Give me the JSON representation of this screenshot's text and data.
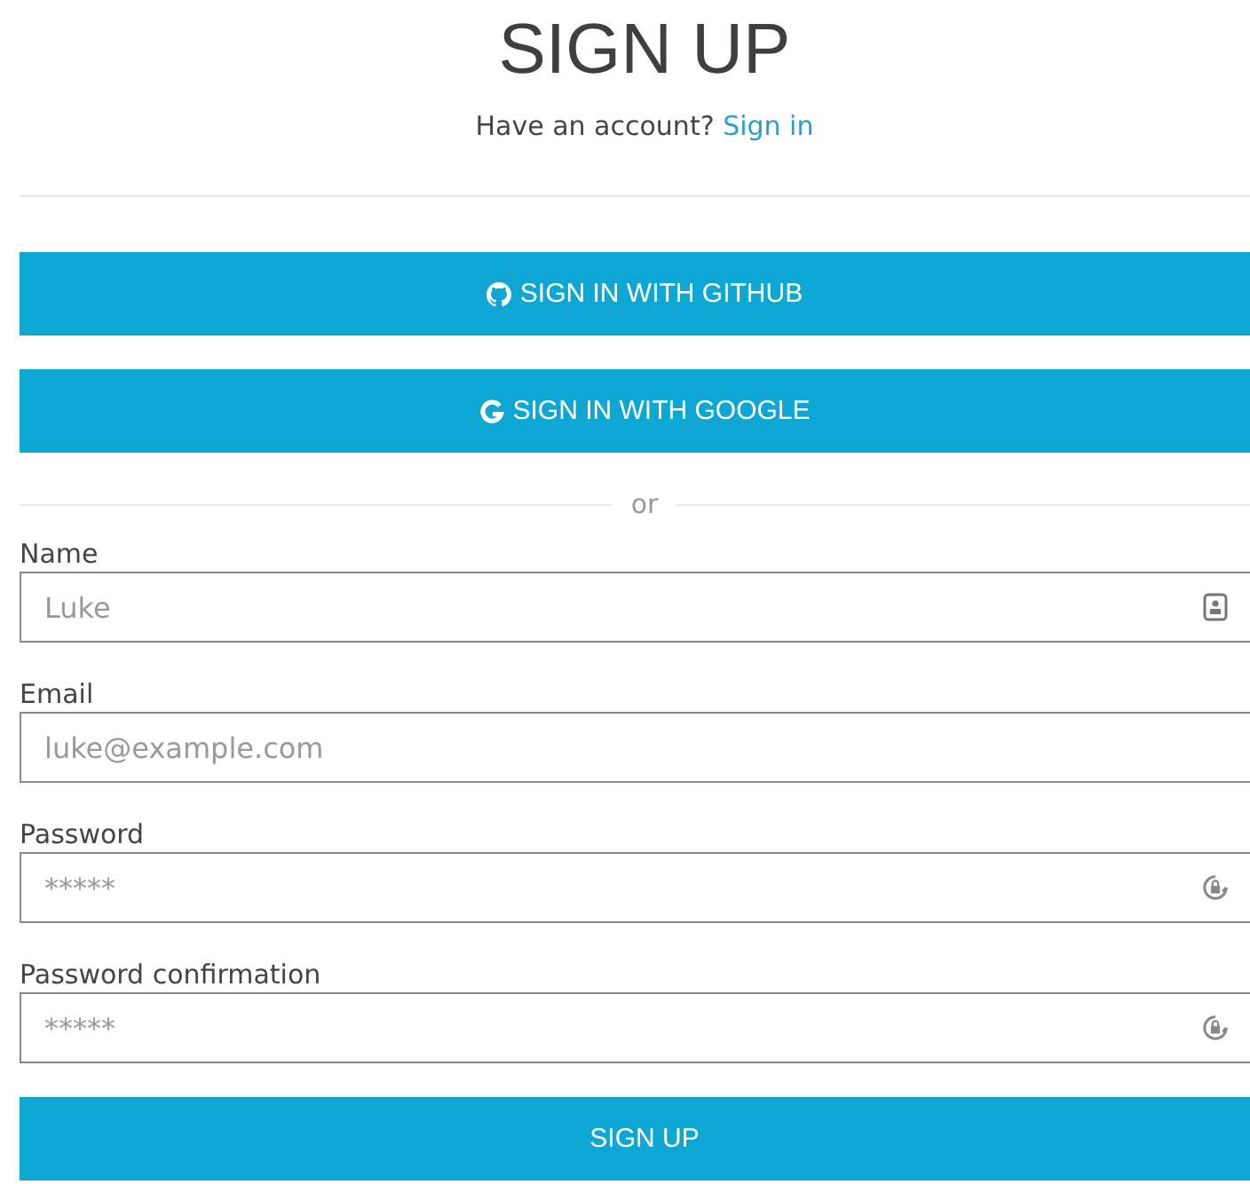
{
  "title": "SIGN UP",
  "subtitle": {
    "text": "Have an account?",
    "link": "Sign in"
  },
  "social_buttons": [
    {
      "label": "SIGN IN WITH GITHUB",
      "kind": "github"
    },
    {
      "label": "SIGN IN WITH GOOGLE",
      "kind": "google"
    }
  ],
  "separator": "or",
  "fields": [
    {
      "label": "Name",
      "placeholder": "Luke",
      "kind": "name"
    },
    {
      "label": "Email",
      "placeholder": "luke@example.com",
      "kind": "email"
    },
    {
      "label": "Password",
      "placeholder": "*****",
      "kind": "password"
    },
    {
      "label": "Password confirmation",
      "placeholder": "*****",
      "kind": "password"
    }
  ],
  "submit": "SIGN UP"
}
